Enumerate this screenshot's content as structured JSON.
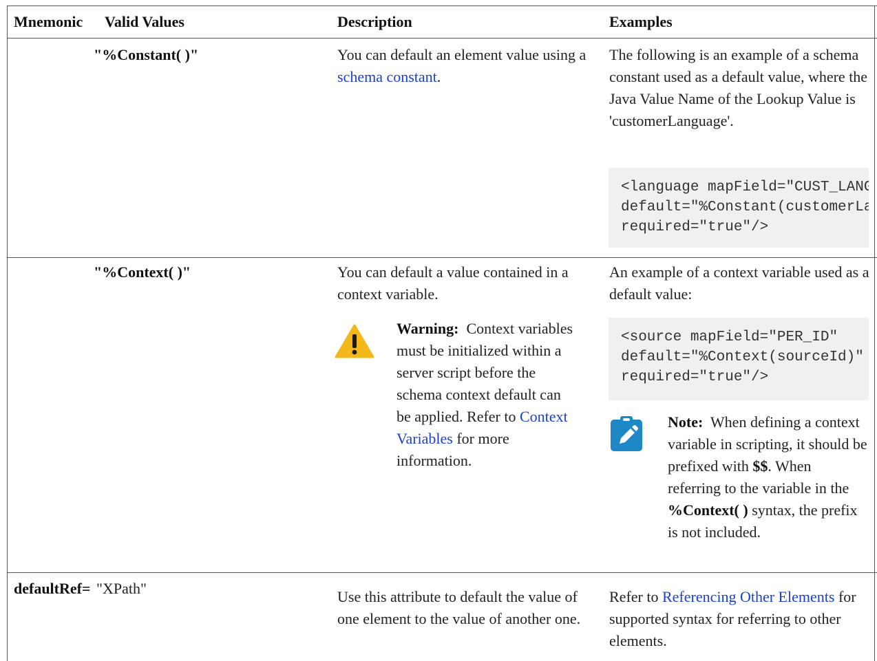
{
  "table": {
    "headers": {
      "mnemonic": "Mnemonic",
      "valid_values": "Valid Values",
      "description": "Description",
      "examples": "Examples"
    },
    "rows": [
      {
        "valid_value": "\"%Constant( )\"",
        "description": {
          "pre": "You can default an element value using a ",
          "link": "schema constant",
          "post": "."
        },
        "example": {
          "text": "The following is an example of a schema constant used as a default value, where the Java Value Name of the Lookup Value is 'customerLanguage'.",
          "code": "<language mapField=\"CUST_LANGUAGE\"\ndefault=\"%Constant(customerLanguage)\"\nrequired=\"true\"/>"
        }
      },
      {
        "valid_value": "\"%Context( )\"",
        "description": {
          "text": "You can default a value contained in a context variable.",
          "warning": {
            "title": "Warning:",
            "text_1": "Context variables must be initialized within a server script before the schema context default can be applied. Refer to ",
            "link": "Context Variables",
            "text_2": " for more information."
          }
        },
        "example": {
          "text": "An example of a context variable used as a default value:",
          "code": "<source mapField=\"PER_ID\"\ndefault=\"%Context(sourceId)\"\nrequired=\"true\"/>",
          "note": {
            "title": "Note:",
            "text_1": "When defining a context variable in scripting, it should be prefixed with ",
            "bold_1": "$$",
            "text_2": ". When referring to the variable in the ",
            "bold_2": "%Context( )",
            "text_3": " syntax, the prefix is not included."
          }
        }
      },
      {
        "mnemonic": "defaultRef=",
        "valid_value": "\"XPath\"",
        "description": {
          "text": "Use this attribute to default the value of one element to the value of another one."
        },
        "example": {
          "pre": "Refer to ",
          "link": "Referencing Other Elements",
          "post": " for supported syntax for referring to other elements."
        }
      }
    ]
  },
  "colors": {
    "link": "#1a3fd6",
    "warning_icon": "#f5b81b",
    "note_icon": "#1e88c7",
    "code_bg": "#f0f0f0"
  },
  "icons": {
    "warning": "warning-triangle-icon",
    "note": "clipboard-pencil-icon"
  }
}
